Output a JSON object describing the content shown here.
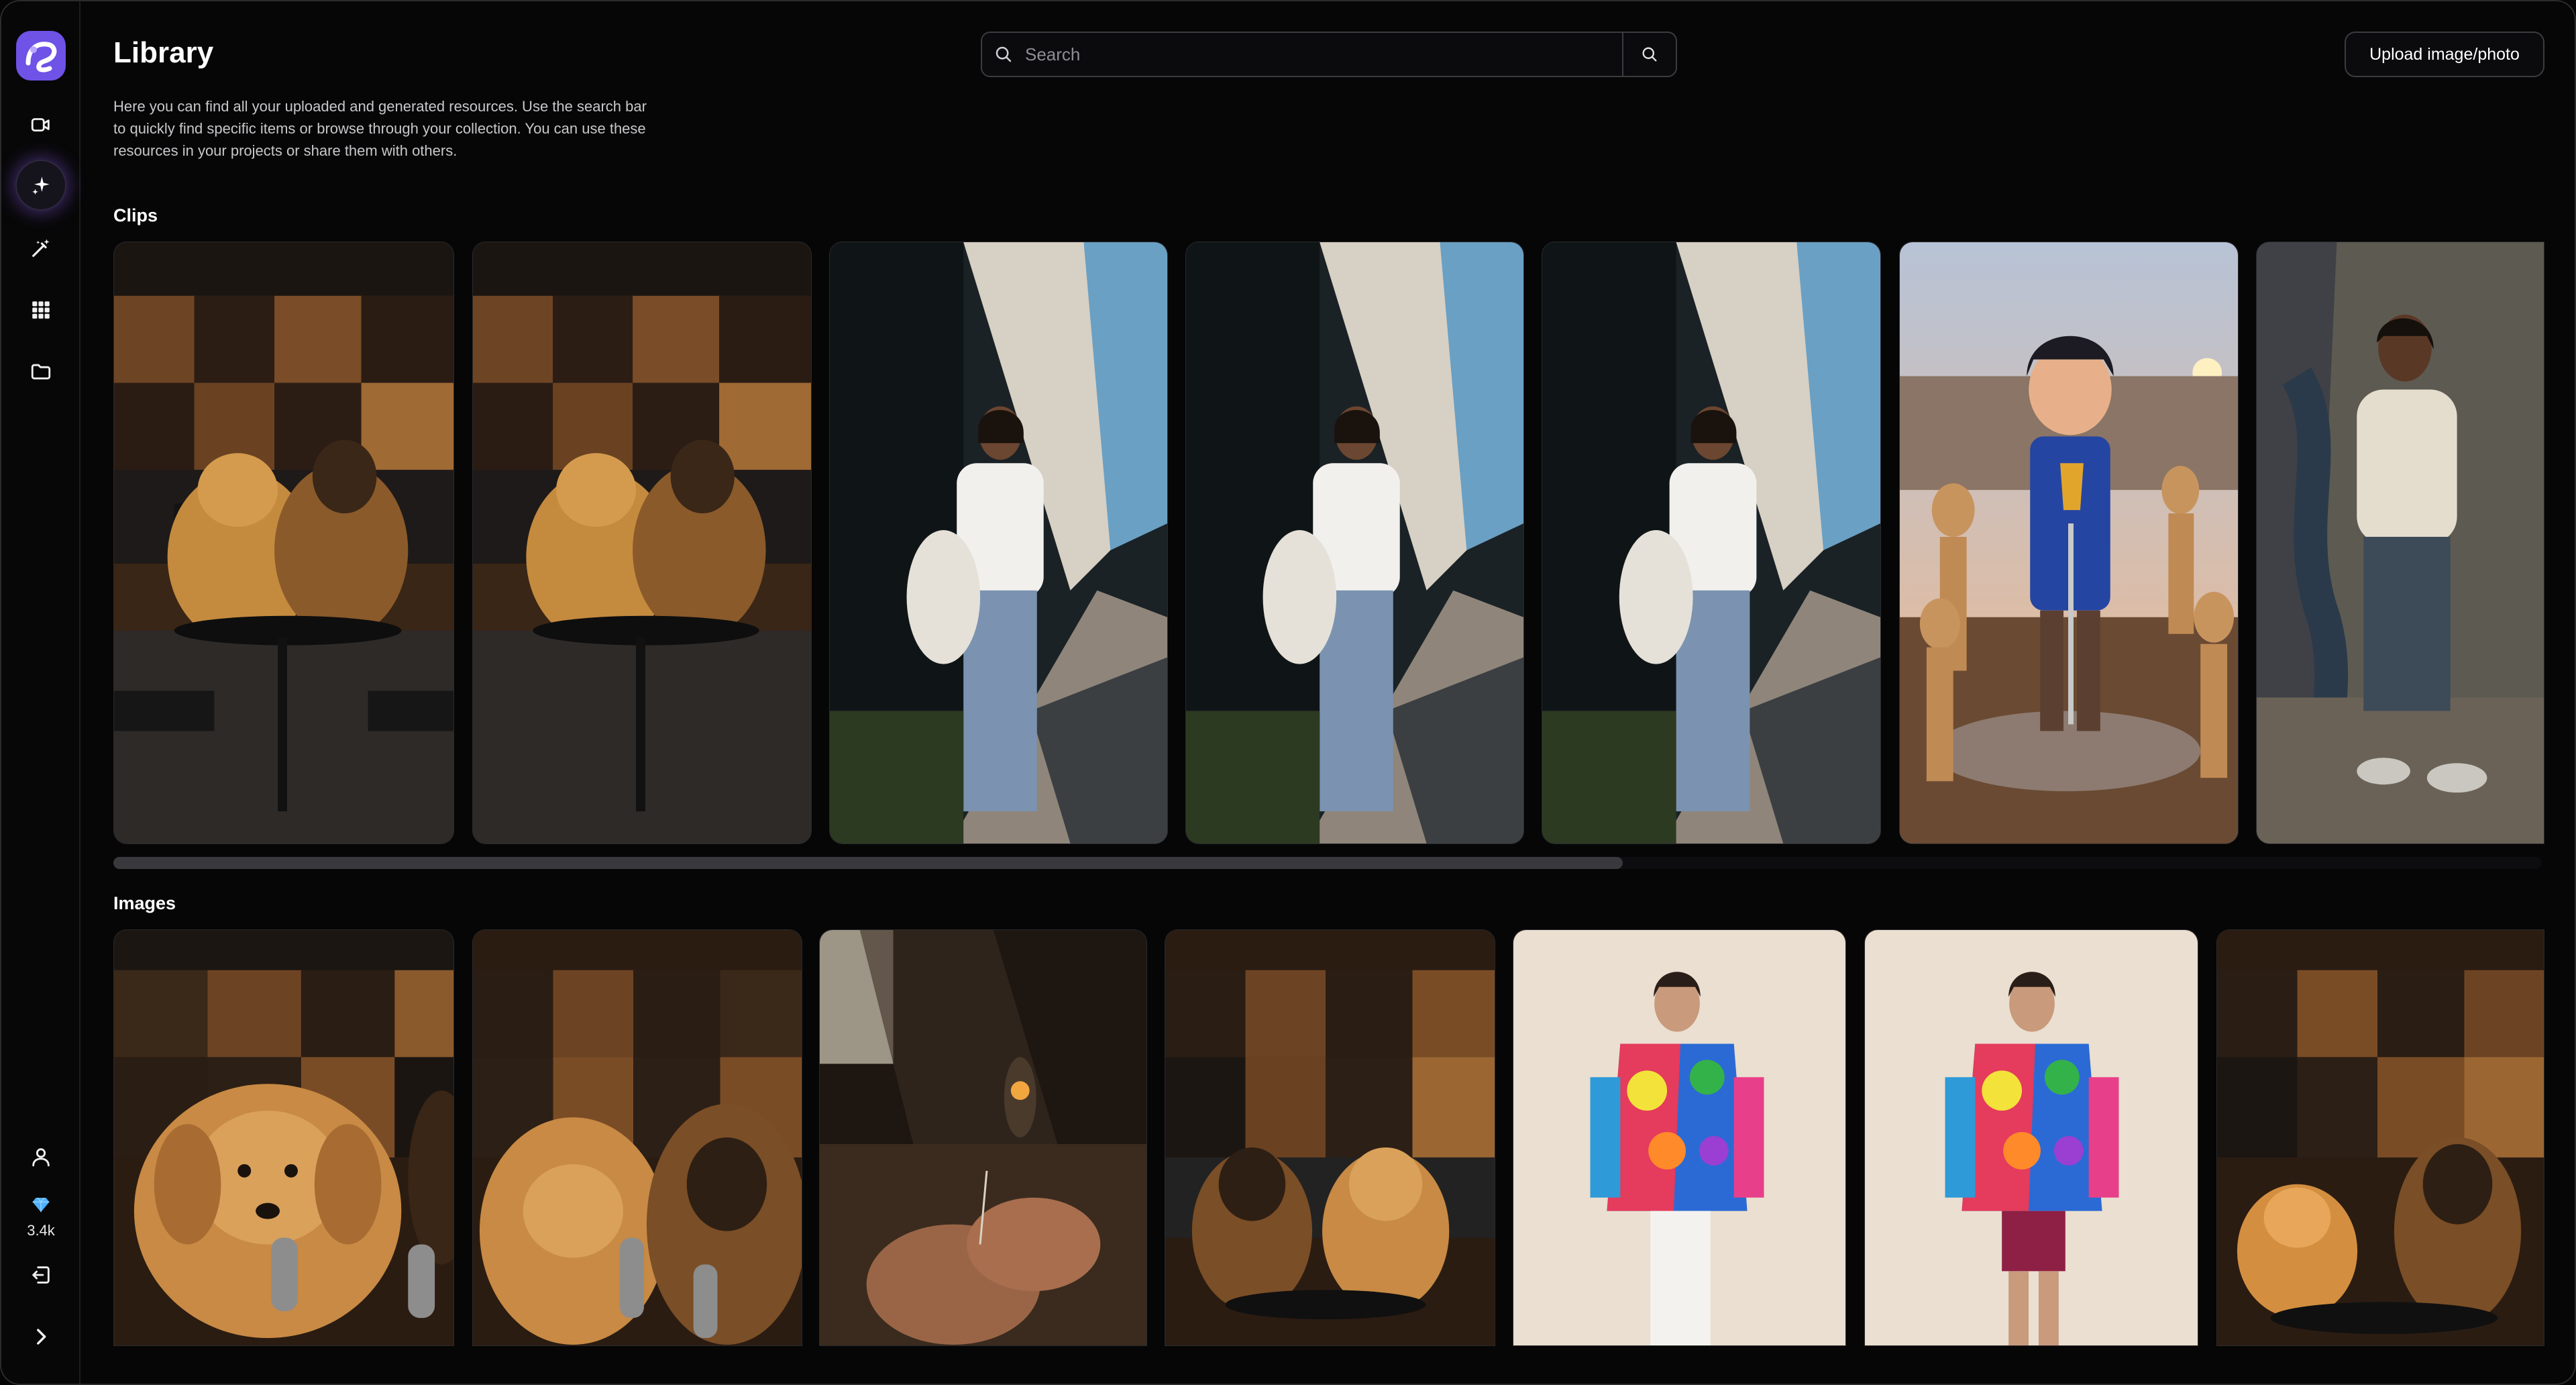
{
  "app": {
    "brand_color": "#7b5cf0"
  },
  "sidebar": {
    "items": [
      {
        "name": "video-clip-icon",
        "active": false
      },
      {
        "name": "sparkle-icon",
        "active": true
      },
      {
        "name": "magic-wand-icon",
        "active": false
      },
      {
        "name": "apps-grid-icon",
        "active": false
      },
      {
        "name": "folder-icon",
        "active": false
      }
    ],
    "bottom": {
      "profile_icon": "user-icon",
      "gem_icon": "diamond-icon",
      "credits": "3.4k",
      "logout_icon": "logout-icon",
      "expand_icon": "chevron-right-icon"
    }
  },
  "header": {
    "title": "Library",
    "description": "Here you can find all your uploaded and generated resources. Use the search bar to quickly find specific items or browse through your collection. You can use these resources in your projects or share them with others.",
    "search": {
      "placeholder": "Search",
      "value": ""
    },
    "upload_label": "Upload image/photo"
  },
  "sections": {
    "clips": {
      "title": "Clips",
      "items": [
        {
          "subject": "dogs-podcast-studio"
        },
        {
          "subject": "dogs-podcast-studio"
        },
        {
          "subject": "woman-street-tote-bag"
        },
        {
          "subject": "woman-street-tote-bag"
        },
        {
          "subject": "woman-street-tote-bag"
        },
        {
          "subject": "animated-boy-knight-wooden-figures"
        },
        {
          "subject": "woman-standing-wet-street"
        }
      ],
      "scroll_position": 0.62
    },
    "images": {
      "title": "Images",
      "items": [
        {
          "subject": "golden-retriever-microphone"
        },
        {
          "subject": "golden-retriever-german-shepherd-microphones"
        },
        {
          "subject": "hands-threading-needle-workshop"
        },
        {
          "subject": "german-shepherd-golden-retriever-studio"
        },
        {
          "subject": "model-floral-jacket-white-pants"
        },
        {
          "subject": "model-floral-jacket-red-skirt"
        },
        {
          "subject": "pomeranian-german-shepherd-studio"
        }
      ]
    }
  }
}
